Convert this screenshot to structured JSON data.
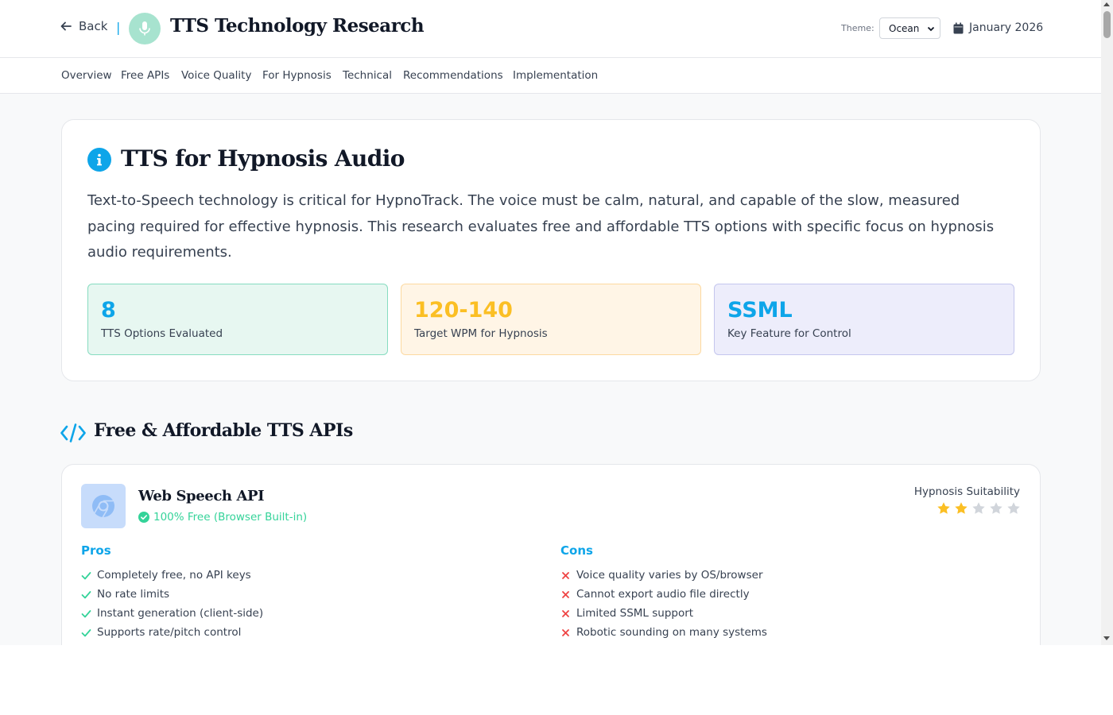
{
  "header": {
    "back_label": "Back",
    "separator": "|",
    "title": "TTS Technology Research",
    "logo_icon": "microphone-icon",
    "theme_label": "Theme:",
    "theme_value": "Ocean",
    "date": "January 2026",
    "date_icon": "calendar-icon"
  },
  "tabs": [
    "Overview",
    "Free APIs",
    "Voice Quality",
    "For Hypnosis",
    "Technical",
    "Recommendations",
    "Implementation"
  ],
  "intro": {
    "icon": "info-icon",
    "title": "TTS for Hypnosis Audio",
    "text": "Text-to-Speech technology is critical for HypnoTrack. The voice must be calm, natural, and capable of the slow, measured pacing required for effective hypnosis. This research evaluates free and affordable TTS options with specific focus on hypnosis audio requirements.",
    "stats": [
      {
        "value": "8",
        "label": "TTS Options Evaluated",
        "color": "#0ea5e9"
      },
      {
        "value": "120-140",
        "label": "Target WPM for Hypnosis",
        "color": "#fbbf24"
      },
      {
        "value": "SSML",
        "label": "Key Feature for Control",
        "color": "#0ea5e9"
      }
    ]
  },
  "section": {
    "icon": "code-icon",
    "title": "Free & Affordable TTS APIs"
  },
  "api": {
    "logo_icon": "chrome-icon",
    "name": "Web Speech API",
    "price": "100% Free (Browser Built-in)",
    "suitability_label": "Hypnosis Suitability",
    "rating": 2,
    "rating_max": 5,
    "pros_title": "Pros",
    "pros": [
      "Completely free, no API keys",
      "No rate limits",
      "Instant generation (client-side)",
      "Supports rate/pitch control"
    ],
    "cons_title": "Cons",
    "cons": [
      "Voice quality varies by OS/browser",
      "Cannot export audio file directly",
      "Limited SSML support",
      "Robotic sounding on many systems"
    ]
  },
  "colors": {
    "accent": "#0ea5e9",
    "success": "#34d399",
    "danger": "#ef4444",
    "star": "#fbbf24"
  }
}
